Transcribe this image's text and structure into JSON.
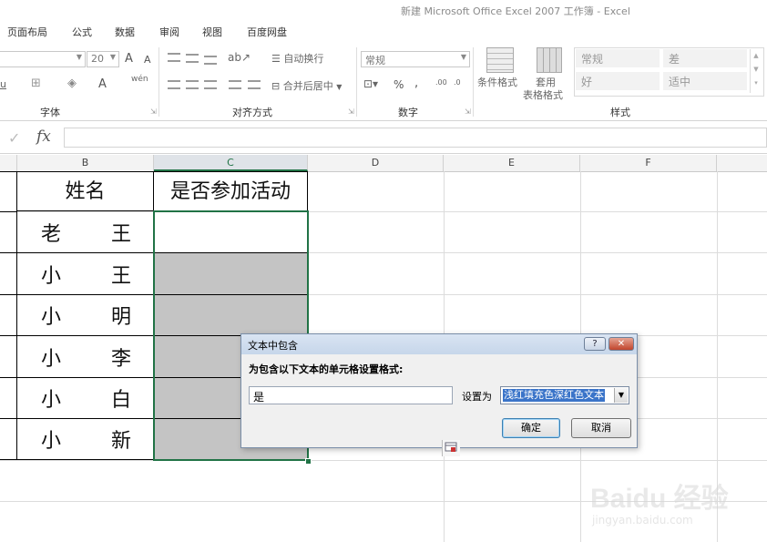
{
  "window": {
    "title": "新建 Microsoft Office Excel 2007 工作簿 - Excel"
  },
  "tabs": [
    "页面布局",
    "公式",
    "数据",
    "审阅",
    "视图",
    "百度网盘"
  ],
  "ribbon": {
    "font_group": {
      "label": "字体",
      "font_size": "20",
      "grow_font": "A",
      "shrink_font": "A",
      "underline": "u",
      "font_color": "A",
      "wen": "wén"
    },
    "alignment_group": {
      "label": "对齐方式",
      "wrap_text": "自动换行",
      "merge_center": "合并后居中"
    },
    "number_group": {
      "label": "数字",
      "format": "常规",
      "percent": "%",
      "comma": ","
    },
    "conditional_format": "条件格式",
    "format_as_table_line1": "套用",
    "format_as_table_line2": "表格格式",
    "styles_group": {
      "label": "样式",
      "normal": "常规",
      "bad": "差",
      "good": "好",
      "neutral": "适中"
    }
  },
  "formula_bar": {
    "fx": "fx",
    "check": "✓",
    "value": ""
  },
  "columns": [
    "B",
    "C",
    "D",
    "E",
    "F"
  ],
  "sheet": {
    "header_name": "姓名",
    "header_activity": "是否参加活动",
    "rows": [
      {
        "first": "老",
        "last": "王"
      },
      {
        "first": "小",
        "last": "王"
      },
      {
        "first": "小",
        "last": "明"
      },
      {
        "first": "小",
        "last": "李"
      },
      {
        "first": "小",
        "last": "白"
      },
      {
        "first": "小",
        "last": "新"
      }
    ]
  },
  "dialog": {
    "title": "文本中包含",
    "help": "?",
    "close": "✕",
    "prompt": "为包含以下文本的单元格设置格式:",
    "input_value": "是",
    "set_label": "设置为",
    "selected_format": "浅红填充色深红色文本",
    "ok": "确定",
    "cancel": "取消"
  },
  "watermark": {
    "logo": "Baidu 经验",
    "url": "jingyan.baidu.com"
  }
}
